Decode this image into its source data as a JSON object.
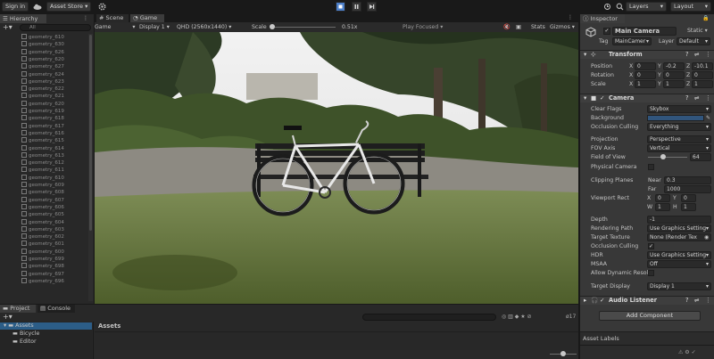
{
  "toolbar": {
    "sign_in": "Sign in",
    "asset_store": "Asset Store",
    "layers": "Layers",
    "layout": "Layout"
  },
  "hierarchy": {
    "tab": "Hierarchy",
    "search_value": "All",
    "items": [
      "geometry_610",
      "geometry_630",
      "geometry_626",
      "geometry_620",
      "geometry_627",
      "geometry_624",
      "geometry_623",
      "geometry_622",
      "geometry_621",
      "geometry_620",
      "geometry_619",
      "geometry_618",
      "geometry_617",
      "geometry_616",
      "geometry_615",
      "geometry_614",
      "geometry_613",
      "geometry_612",
      "geometry_611",
      "geometry_610",
      "geometry_609",
      "geometry_608",
      "geometry_607",
      "geometry_606",
      "geometry_605",
      "geometry_604",
      "geometry_603",
      "geometry_602",
      "geometry_601",
      "geometry_600",
      "geometry_699",
      "geometry_698",
      "geometry_697",
      "geometry_696"
    ]
  },
  "scene_tabs": {
    "scene": "Scene",
    "game": "Game"
  },
  "game_bar": {
    "game": "Game",
    "display": "Display 1",
    "resolution": "QHD (2560x1440)",
    "scale_label": "Scale",
    "scale_value": "0.51x",
    "play_mode": "Play Focused",
    "stats": "Stats",
    "gizmos": "Gizmos"
  },
  "inspector": {
    "tab": "Inspector",
    "object_name": "Main Camera",
    "static_label": "Static",
    "tag_label": "Tag",
    "tag_value": "MainCamer",
    "layer_label": "Layer",
    "layer_value": "Default",
    "transform": {
      "title": "Transform",
      "position_label": "Position",
      "rotation_label": "Rotation",
      "scale_label": "Scale",
      "position": {
        "x": "0",
        "y": "-0.2",
        "z": "-10.1"
      },
      "rotation": {
        "x": "0",
        "y": "0",
        "z": "0"
      },
      "scale": {
        "x": "1",
        "y": "1",
        "z": "1"
      }
    },
    "camera": {
      "title": "Camera",
      "clear_flags_label": "Clear Flags",
      "clear_flags": "Skybox",
      "background_label": "Background",
      "background_color": "#31557c",
      "culling_label": "Occlusion Culling",
      "culling": "Everything",
      "projection_label": "Projection",
      "projection": "Perspective",
      "fov_axis_label": "FOV Axis",
      "fov_axis": "Vertical",
      "fov_label": "Field of View",
      "fov": "64",
      "physical_label": "Physical Camera",
      "clipping_label": "Clipping Planes",
      "near_label": "Near",
      "near": "0.3",
      "far_label": "Far",
      "far": "1000",
      "viewport_label": "Viewport Rect",
      "vx": "0",
      "vy": "0",
      "vw": "1",
      "vh": "1",
      "depth_label": "Depth",
      "depth": "-1",
      "rendering_path_label": "Rendering Path",
      "rendering_path": "Use Graphics Setting",
      "target_texture_label": "Target Texture",
      "target_texture": "None (Render Tex",
      "occlusion_label": "Occlusion Culling",
      "hdr_label": "HDR",
      "hdr": "Use Graphics Setting",
      "msaa_label": "MSAA",
      "msaa": "Off",
      "dynamic_label": "Allow Dynamic Resol",
      "target_display_label": "Target Display",
      "target_display": "Display 1"
    },
    "audio_listener": "Audio Listener",
    "add_component": "Add Component",
    "asset_labels": "Asset Labels"
  },
  "project": {
    "tab_project": "Project",
    "tab_console": "Console",
    "assets_root": "Assets",
    "folders": [
      "Bicycle",
      "Editor"
    ],
    "breadcrumb": "Assets",
    "count": "17"
  },
  "colors": {
    "accent": "#4c7fc9",
    "panel": "#383838",
    "dark": "#191919"
  }
}
